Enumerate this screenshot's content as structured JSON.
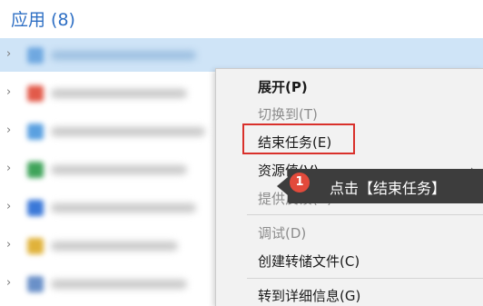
{
  "header": {
    "title": "应用 (8)"
  },
  "rows": [
    {
      "icon_color": "#6fa8e0"
    },
    {
      "icon_color": "#e25a4a"
    },
    {
      "icon_color": "#5aa0e0"
    },
    {
      "icon_color": "#3fa35a"
    },
    {
      "icon_color": "#3a78d8"
    },
    {
      "icon_color": "#e0b23a"
    },
    {
      "icon_color": "#6a90c8"
    }
  ],
  "context_menu": {
    "items": [
      {
        "label": "展开(P)",
        "state": "bold"
      },
      {
        "label": "切换到(T)",
        "state": "disabled"
      },
      {
        "label": "结束任务(E)",
        "state": "normal"
      },
      {
        "label": "资源值(V)",
        "state": "normal"
      },
      {
        "label": "提供反馈(B)",
        "state": "disabled"
      },
      {
        "label": "调试(D)",
        "state": "disabled"
      },
      {
        "label": "创建转储文件(C)",
        "state": "normal"
      },
      {
        "label": "转到详细信息(G)",
        "state": "normal"
      }
    ]
  },
  "callout": {
    "badge": "1",
    "text": "点击【结束任务】"
  },
  "colors": {
    "accent": "#2e6fc4",
    "highlight": "#d9302b",
    "badge": "#e24a3b"
  }
}
